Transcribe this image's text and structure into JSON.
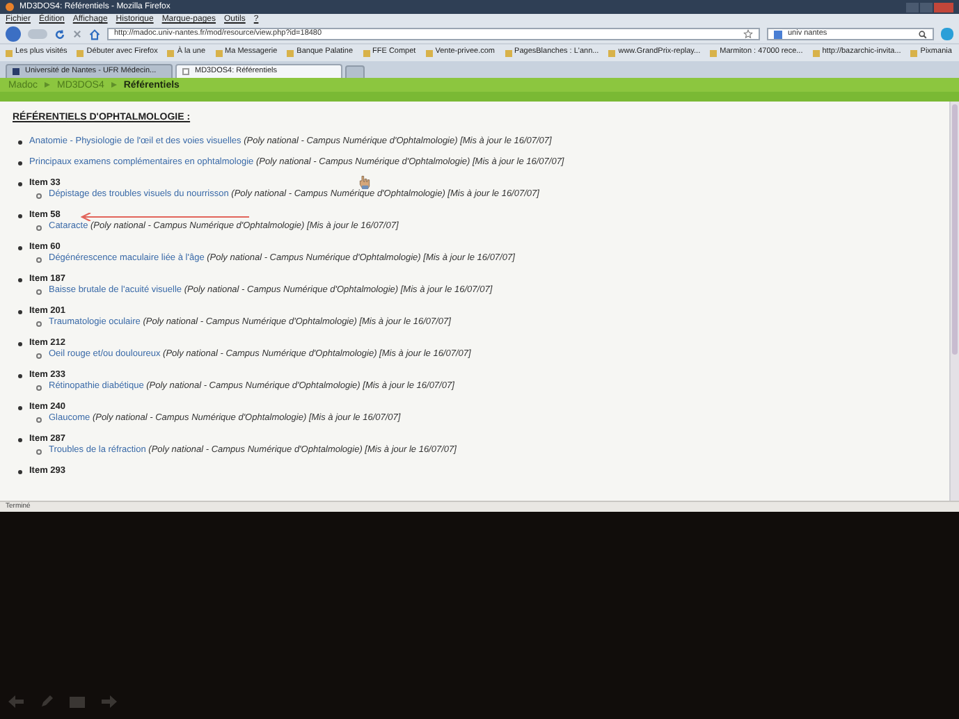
{
  "window": {
    "title": "MD3DOS4: Référentiels - Mozilla Firefox"
  },
  "menu": [
    "Fichier",
    "Édition",
    "Affichage",
    "Historique",
    "Marque-pages",
    "Outils",
    "?"
  ],
  "address_bar": {
    "value": "http://madoc.univ-nantes.fr/mod/resource/view.php?id=18480"
  },
  "search": {
    "value": "univ nantes"
  },
  "bookmarks": [
    "Les plus visités",
    "Débuter avec Firefox",
    "À la une",
    "Ma Messagerie",
    "Banque Palatine",
    "FFE Compet",
    "Vente-privee.com",
    "PagesBlanches : L'ann...",
    "www.GrandPrix-replay...",
    "Marmiton : 47000 rece...",
    "http://bazarchic-invita...",
    "Pixmania"
  ],
  "tabs": [
    {
      "label": "Université de Nantes - UFR Médecin...",
      "selected": false
    },
    {
      "label": "MD3DOS4: Référentiels",
      "selected": true
    }
  ],
  "breadcrumb": [
    {
      "label": "Madoc",
      "current": false
    },
    {
      "label": "MD3DOS4",
      "current": false
    },
    {
      "label": "Référentiels",
      "current": true
    }
  ],
  "heading": "RÉFÉRENTIELS D'OPHTALMOLOGIE :",
  "entries": [
    {
      "kind": "link",
      "link": "Anatomie - Physiologie de l'œil et des voies visuelles",
      "source": "(Poly national - Campus Numérique d'Ophtalmologie)",
      "date": "[Mis à jour le 16/07/07]"
    },
    {
      "kind": "link",
      "link": "Principaux examens complémentaires en ophtalmologie",
      "source": "(Poly national - Campus Numérique d'Ophtalmologie)",
      "date": "[Mis à jour le 16/07/07]"
    },
    {
      "kind": "item",
      "label": "Item 33",
      "children": [
        {
          "link": "Dépistage des troubles visuels du nourrisson",
          "source": "(Poly national - Campus Numérique d'Ophtalmologie)",
          "date": "[Mis à jour le 16/07/07]"
        }
      ]
    },
    {
      "kind": "item",
      "label": "Item 58",
      "children": [
        {
          "link": "Cataracte",
          "source": "(Poly national - Campus Numérique d'Ophtalmologie)",
          "date": "[Mis à jour le 16/07/07]"
        }
      ]
    },
    {
      "kind": "item",
      "label": "Item 60",
      "children": [
        {
          "link": "Dégénérescence maculaire liée à l'âge",
          "source": "(Poly national - Campus Numérique d'Ophtalmologie)",
          "date": "[Mis à jour le 16/07/07]"
        }
      ]
    },
    {
      "kind": "item",
      "label": "Item 187",
      "children": [
        {
          "link": "Baisse brutale de l'acuité visuelle",
          "source": "(Poly national - Campus Numérique d'Ophtalmologie)",
          "date": "[Mis à jour le 16/07/07]"
        }
      ]
    },
    {
      "kind": "item",
      "label": "Item 201",
      "children": [
        {
          "link": "Traumatologie oculaire",
          "source": "(Poly national - Campus Numérique d'Ophtalmologie)",
          "date": "[Mis à jour le 16/07/07]"
        }
      ]
    },
    {
      "kind": "item",
      "label": "Item 212",
      "children": [
        {
          "link": "Oeil rouge et/ou douloureux",
          "source": "(Poly national - Campus Numérique d'Ophtalmologie)",
          "date": "[Mis à jour le 16/07/07]"
        }
      ]
    },
    {
      "kind": "item",
      "label": "Item 233",
      "children": [
        {
          "link": "Rétinopathie diabétique",
          "source": "(Poly national - Campus Numérique d'Ophtalmologie)",
          "date": "[Mis à jour le 16/07/07]"
        }
      ]
    },
    {
      "kind": "item",
      "label": "Item 240",
      "children": [
        {
          "link": "Glaucome",
          "source": "(Poly national - Campus Numérique d'Ophtalmologie)",
          "date": "[Mis à jour le 16/07/07]"
        }
      ]
    },
    {
      "kind": "item",
      "label": "Item 287",
      "children": [
        {
          "link": "Troubles de la réfraction",
          "source": "(Poly national - Campus Numérique d'Ophtalmologie)",
          "date": "[Mis à jour le 16/07/07]"
        }
      ]
    },
    {
      "kind": "item",
      "label": "Item 293"
    }
  ],
  "status_bar": {
    "text": "Terminé"
  }
}
